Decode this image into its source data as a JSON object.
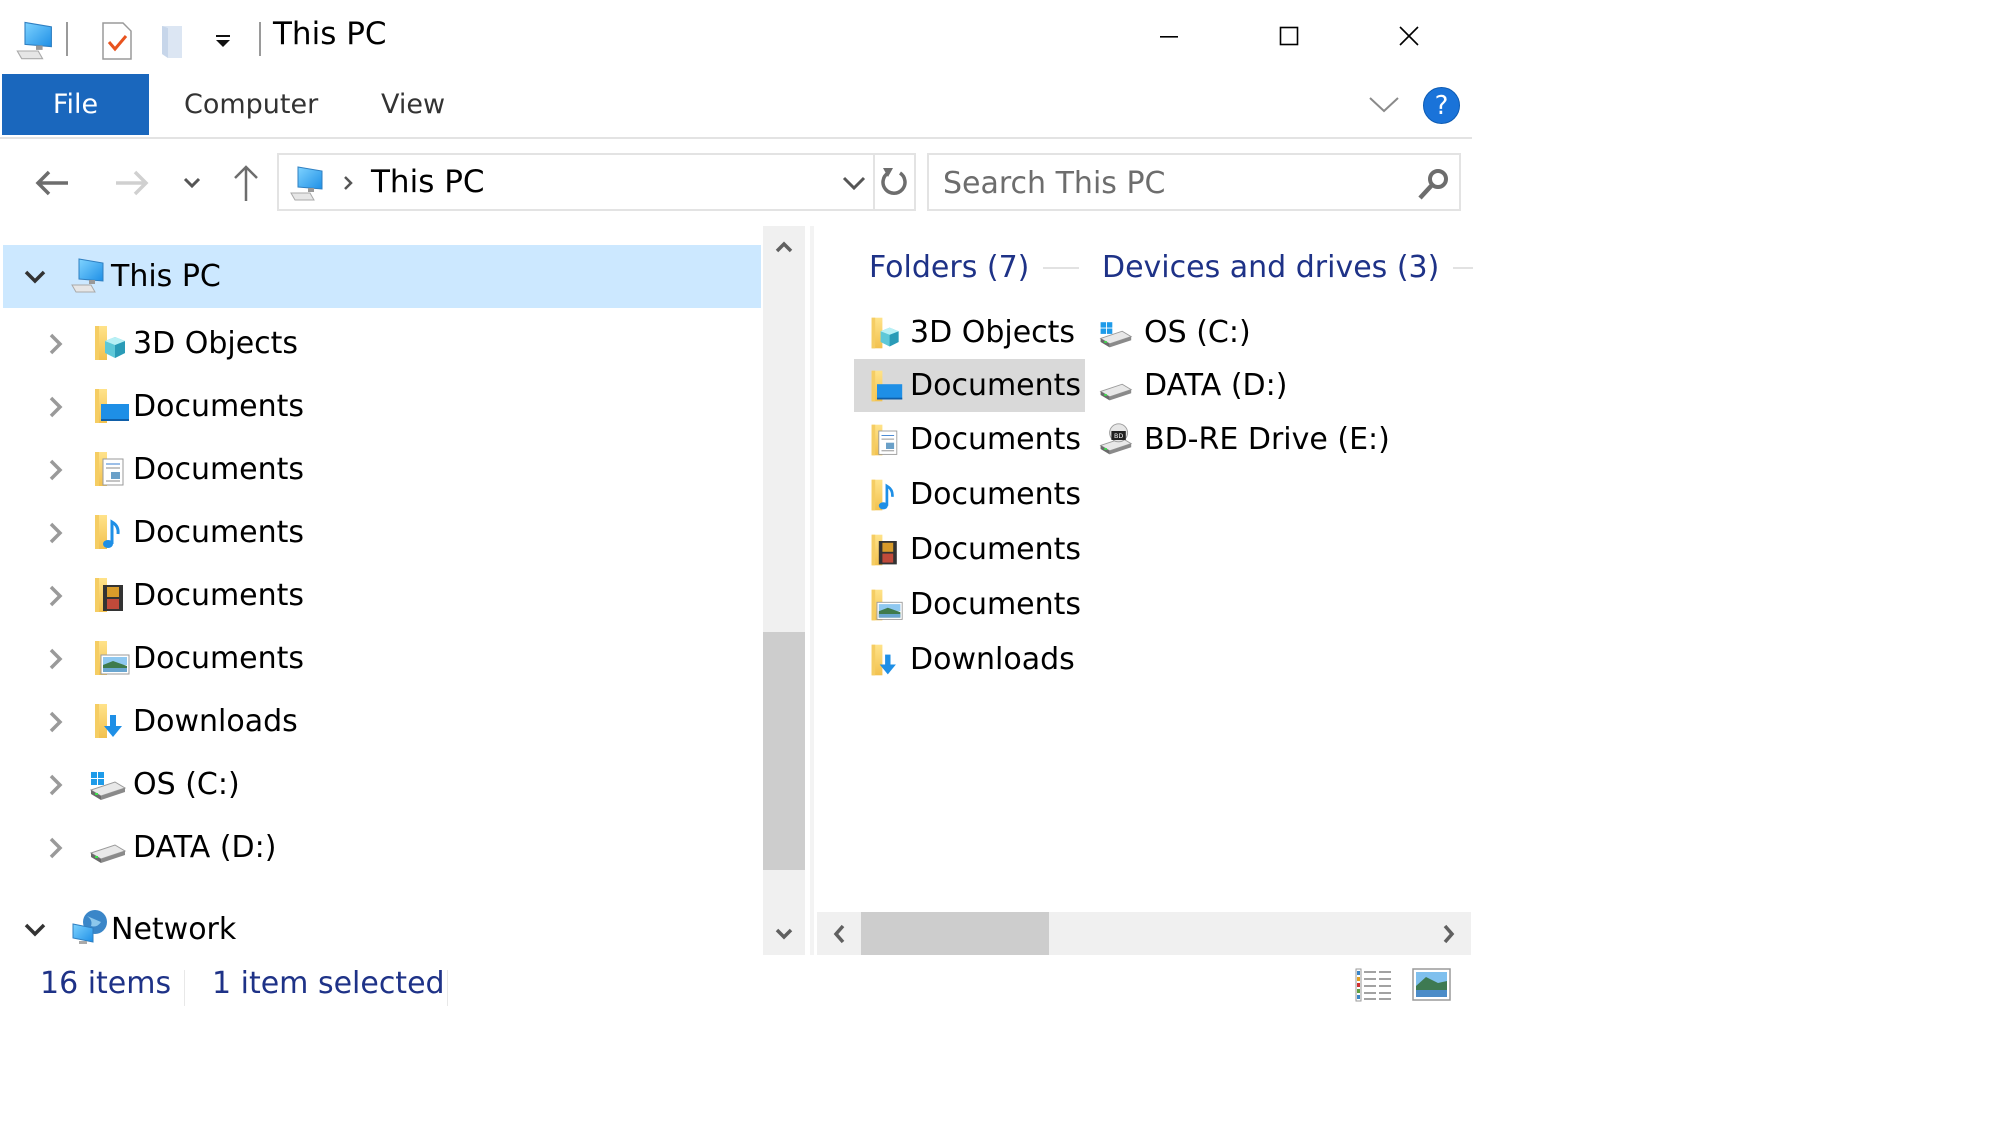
{
  "window": {
    "title": "This PC",
    "qat_icons": [
      "computer-icon",
      "properties-icon",
      "new-folder-icon",
      "customize-qat-icon"
    ],
    "controls": {
      "minimize": "minimize",
      "maximize": "maximize",
      "close": "close"
    }
  },
  "ribbon": {
    "tabs": [
      {
        "label": "File",
        "active": true
      },
      {
        "label": "Computer"
      },
      {
        "label": "View"
      }
    ],
    "accent": "#1a67bd",
    "help_label": "?"
  },
  "navbar": {
    "back_icon": "arrow-left-icon",
    "forward_icon": "arrow-right-icon",
    "recent_icon": "chevron-down-icon",
    "up_icon": "arrow-up-icon",
    "address": {
      "segments": [
        "This PC"
      ]
    },
    "search": {
      "placeholder": "Search This PC",
      "value": ""
    }
  },
  "nav_pane": {
    "items": [
      {
        "label": "This PC",
        "level": 0,
        "expanded": true,
        "selected": true,
        "icon": "computer-icon"
      },
      {
        "label": "3D Objects",
        "level": 1,
        "icon": "3d-objects-folder-icon"
      },
      {
        "label": "Documents",
        "level": 1,
        "icon": "desktop-folder-icon"
      },
      {
        "label": "Documents",
        "level": 1,
        "icon": "documents-folder-icon"
      },
      {
        "label": "Documents",
        "level": 1,
        "icon": "music-folder-icon"
      },
      {
        "label": "Documents",
        "level": 1,
        "icon": "videos-folder-icon"
      },
      {
        "label": "Documents",
        "level": 1,
        "icon": "pictures-folder-icon"
      },
      {
        "label": "Downloads",
        "level": 1,
        "icon": "downloads-folder-icon"
      },
      {
        "label": "OS (C:)",
        "level": 1,
        "icon": "windows-drive-icon"
      },
      {
        "label": "DATA (D:)",
        "level": 1,
        "icon": "drive-icon"
      },
      {
        "label": "Network",
        "level": 0,
        "expanded": true,
        "icon": "network-icon"
      }
    ]
  },
  "content": {
    "groups": [
      {
        "header": "Folders (7)",
        "items": [
          {
            "label": "3D Objects",
            "icon": "3d-objects-folder-icon"
          },
          {
            "label": "Documents",
            "icon": "desktop-folder-icon",
            "selected": true
          },
          {
            "label": "Documents",
            "icon": "documents-folder-icon"
          },
          {
            "label": "Documents",
            "icon": "music-folder-icon"
          },
          {
            "label": "Documents",
            "icon": "videos-folder-icon"
          },
          {
            "label": "Documents",
            "icon": "pictures-folder-icon"
          },
          {
            "label": "Downloads",
            "icon": "downloads-folder-icon"
          }
        ]
      },
      {
        "header": "Devices and drives (3)",
        "items": [
          {
            "label": "OS (C:)",
            "icon": "windows-drive-icon"
          },
          {
            "label": "DATA (D:)",
            "icon": "drive-icon"
          },
          {
            "label": "BD-RE Drive (E:)",
            "icon": "bd-drive-icon"
          }
        ]
      }
    ],
    "header_color": "#1e3287"
  },
  "status": {
    "item_count": "16 items",
    "selection": "1 item selected",
    "views": [
      "details-view",
      "large-icons-view"
    ]
  }
}
